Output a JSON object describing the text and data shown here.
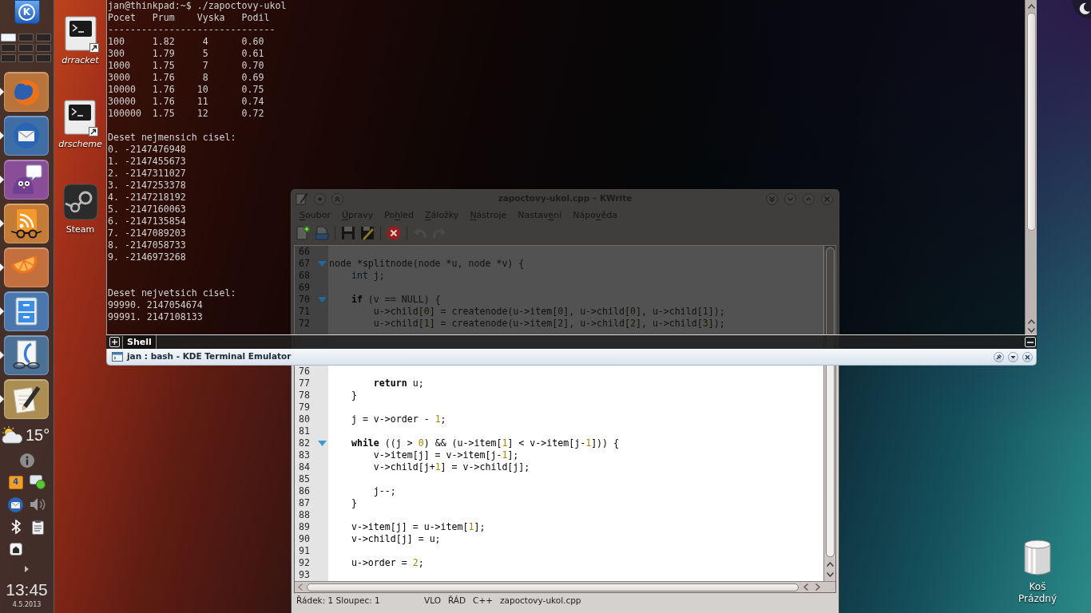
{
  "panel": {
    "menu_button": {
      "label": "K"
    },
    "pager": [
      {
        "selected": true
      },
      {
        "selected": false
      },
      {
        "selected": false
      },
      {
        "selected": false
      },
      {
        "selected": false
      },
      {
        "selected": false
      },
      {
        "selected": false
      },
      {
        "selected": false
      },
      {
        "selected": false
      }
    ],
    "launchers": [
      {
        "kind": "globe",
        "color": "#b8743a",
        "running": true
      },
      {
        "kind": "mail",
        "color": "#3f6ea6",
        "running": true
      },
      {
        "kind": "chat",
        "color": "#8a4e98",
        "running": true
      },
      {
        "kind": "rss",
        "color": "#c47c36",
        "running": true
      },
      {
        "kind": "citrus",
        "color": "#c4703e",
        "running": true
      },
      {
        "kind": "cabinet",
        "color": "#4a78ae",
        "running": true
      },
      {
        "kind": "viewer",
        "color": "#4c7196",
        "running": true
      },
      {
        "kind": "editor",
        "color": "#ad8e52",
        "running": true
      }
    ],
    "weather": {
      "temperature": "15°"
    },
    "tray": {
      "calendar_day": "4"
    },
    "clock": {
      "time": "13:45",
      "date": "4.5.2013"
    }
  },
  "desktop": {
    "icons": [
      {
        "label": "drracket",
        "kind": "terminal",
        "link": true
      },
      {
        "label": "drscheme",
        "kind": "terminal",
        "link": true
      },
      {
        "label": "Steam",
        "kind": "steam",
        "link": false
      }
    ],
    "trash": {
      "name": "Koš",
      "status": "Prázdný"
    }
  },
  "terminal": {
    "output": [
      [
        "jan@thinkpad:~$ ./zapoctovy-ukol",
        "Pocet   Prum    Vyska   Podil",
        "------------------------------",
        "100     1.82     4      0.60",
        "300     1.79     5      0.61",
        "1000    1.75     7      0.70",
        "3000    1.76     8      0.69",
        "10000   1.76    10      0.75",
        "30000   1.76    11      0.74",
        "100000  1.75    12      0.72"
      ],
      [
        "Deset nejmensich cisel:",
        "0. -2147476948",
        "1. -2147455673",
        "2. -2147311027",
        "3. -2147253378",
        "4. -2147218192",
        "5. -2147160063",
        "6. -2147135854",
        "7. -2147089203",
        "8. -2147058733",
        "9. -2146973268"
      ],
      [
        "Deset nejvetsich cisel:",
        "99990. 2147054674",
        "99991. 2147108133"
      ]
    ],
    "tabs": [
      {
        "label": "Shell",
        "selected": true
      }
    ],
    "title": "jan : bash - KDE Terminal Emulator"
  },
  "kwrite": {
    "title": "zapoctovy-ukol.cpp – KWrite",
    "menu": [
      {
        "key": "S",
        "after": "oubor"
      },
      {
        "key": "Ú",
        "after": "pravy"
      },
      {
        "before": "Po",
        "key": "h",
        "after": "led"
      },
      {
        "key": "Z",
        "after": "áložky"
      },
      {
        "key": "N",
        "after": "ástroje"
      },
      {
        "before": "Nastav",
        "key": "e",
        "after": "ní"
      },
      {
        "before": "Nápo",
        "key": "v",
        "after": "ěda"
      }
    ],
    "toolbar": [
      [
        {
          "kind": "new",
          "disabled": false
        },
        {
          "kind": "open",
          "disabled": false
        }
      ],
      [
        {
          "kind": "save",
          "disabled": false
        },
        {
          "kind": "save_as",
          "disabled": false
        }
      ],
      [
        {
          "kind": "close",
          "disabled": false
        }
      ],
      [
        {
          "kind": "undo",
          "disabled": true
        },
        {
          "kind": "redo",
          "disabled": true
        }
      ]
    ],
    "editor": {
      "line_groups": [
        [
          {
            "number": "66",
            "fold": false
          },
          {
            "number": "67",
            "fold": true,
            "tokens": [
              {
                "text": "node *splitnode(node *u, node *v) {",
                "kind": "plain"
              }
            ]
          },
          {
            "number": "68",
            "fold": false,
            "tokens": [
              {
                "text": "    int",
                "kind": "type"
              },
              {
                "text": " j;",
                "kind": "plain"
              }
            ]
          },
          {
            "number": "69",
            "fold": false
          },
          {
            "number": "70",
            "fold": true,
            "tokens": [
              {
                "text": "    if",
                "kind": "keyword"
              },
              {
                "text": " (v == NULL) {",
                "kind": "plain"
              }
            ]
          },
          {
            "number": "71",
            "fold": false,
            "tokens": [
              {
                "text": "        u->child[",
                "kind": "plain"
              },
              {
                "text": "0",
                "kind": "number"
              },
              {
                "text": "] = createnode(u->item[",
                "kind": "plain"
              },
              {
                "text": "0",
                "kind": "number"
              },
              {
                "text": "], u->child[",
                "kind": "plain"
              },
              {
                "text": "0",
                "kind": "number"
              },
              {
                "text": "], u->child[",
                "kind": "plain"
              },
              {
                "text": "1",
                "kind": "number"
              },
              {
                "text": "]);",
                "kind": "plain"
              }
            ]
          },
          {
            "number": "72",
            "fold": false,
            "tokens": [
              {
                "text": "        u->child[",
                "kind": "plain"
              },
              {
                "text": "1",
                "kind": "number"
              },
              {
                "text": "] = createnode(u->item[",
                "kind": "plain"
              },
              {
                "text": "2",
                "kind": "number"
              },
              {
                "text": "], u->child[",
                "kind": "plain"
              },
              {
                "text": "2",
                "kind": "number"
              },
              {
                "text": "], u->child[",
                "kind": "plain"
              },
              {
                "text": "3",
                "kind": "number"
              },
              {
                "text": "]);",
                "kind": "plain"
              }
            ]
          }
        ],
        [
          {
            "number": "76",
            "fold": false
          },
          {
            "number": "77",
            "fold": false,
            "tokens": [
              {
                "text": "        return",
                "kind": "keyword"
              },
              {
                "text": " u;",
                "kind": "plain"
              }
            ]
          },
          {
            "number": "78",
            "fold": false,
            "tokens": [
              {
                "text": "    }",
                "kind": "plain"
              }
            ]
          },
          {
            "number": "79",
            "fold": false
          },
          {
            "number": "80",
            "fold": false,
            "tokens": [
              {
                "text": "    j = v->order - ",
                "kind": "plain"
              },
              {
                "text": "1",
                "kind": "number"
              },
              {
                "text": ";",
                "kind": "plain"
              }
            ]
          },
          {
            "number": "81",
            "fold": false
          },
          {
            "number": "82",
            "fold": true,
            "tokens": [
              {
                "text": "    while",
                "kind": "keyword"
              },
              {
                "text": " ((j > ",
                "kind": "plain"
              },
              {
                "text": "0",
                "kind": "number"
              },
              {
                "text": ") && (u->item[",
                "kind": "plain"
              },
              {
                "text": "1",
                "kind": "number"
              },
              {
                "text": "] < v->item[j-",
                "kind": "plain"
              },
              {
                "text": "1",
                "kind": "number"
              },
              {
                "text": "])) {",
                "kind": "plain"
              }
            ]
          },
          {
            "number": "83",
            "fold": false,
            "tokens": [
              {
                "text": "        v->item[j] = v->item[j-",
                "kind": "plain"
              },
              {
                "text": "1",
                "kind": "number"
              },
              {
                "text": "];",
                "kind": "plain"
              }
            ]
          },
          {
            "number": "84",
            "fold": false,
            "tokens": [
              {
                "text": "        v->child[j+",
                "kind": "plain"
              },
              {
                "text": "1",
                "kind": "number"
              },
              {
                "text": "] = v->child[j];",
                "kind": "plain"
              }
            ]
          },
          {
            "number": "85",
            "fold": false
          },
          {
            "number": "86",
            "fold": false,
            "tokens": [
              {
                "text": "        j--;",
                "kind": "plain"
              }
            ]
          },
          {
            "number": "87",
            "fold": false,
            "tokens": [
              {
                "text": "    }",
                "kind": "plain"
              }
            ]
          },
          {
            "number": "88",
            "fold": false
          },
          {
            "number": "89",
            "fold": false,
            "tokens": [
              {
                "text": "    v->item[j] = u->item[",
                "kind": "plain"
              },
              {
                "text": "1",
                "kind": "number"
              },
              {
                "text": "];",
                "kind": "plain"
              }
            ]
          },
          {
            "number": "90",
            "fold": false,
            "tokens": [
              {
                "text": "    v->child[j] = u;",
                "kind": "plain"
              }
            ]
          },
          {
            "number": "91",
            "fold": false
          },
          {
            "number": "92",
            "fold": false,
            "tokens": [
              {
                "text": "    u->order = ",
                "kind": "plain"
              },
              {
                "text": "2",
                "kind": "number"
              },
              {
                "text": ";",
                "kind": "plain"
              }
            ]
          },
          {
            "number": "93",
            "fold": false
          }
        ]
      ]
    },
    "status_bar": [
      "Řádek: 1 Sloupec: 1",
      "VLO",
      "ŘÁD",
      "C++",
      "zapoctovy-ukol.cpp"
    ]
  }
}
